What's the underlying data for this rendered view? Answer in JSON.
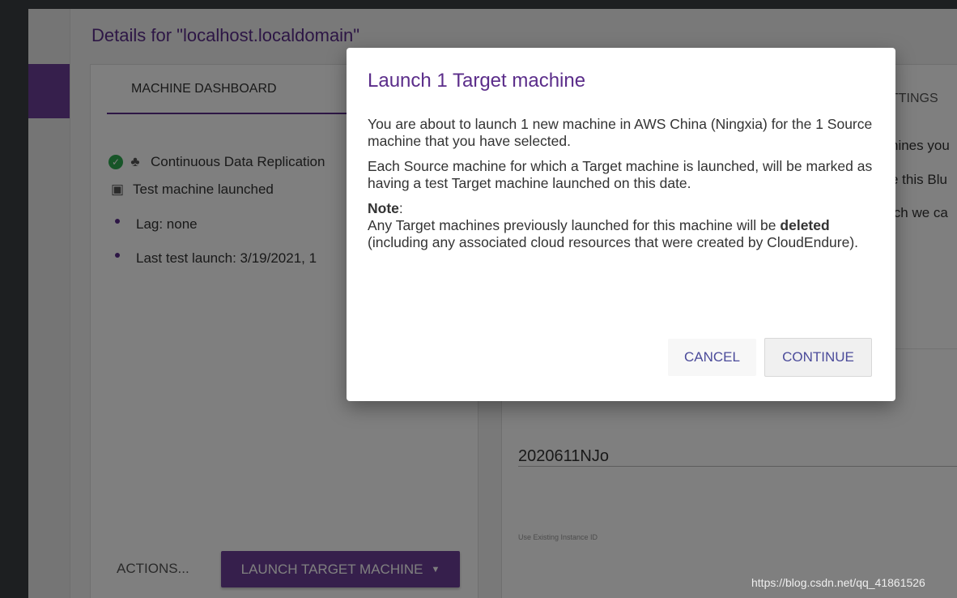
{
  "page": {
    "title": "Details for \"localhost.localdomain\""
  },
  "left_card": {
    "tab_label": "MACHINE DASHBOARD",
    "status_items": [
      {
        "label": "Continuous Data Replication",
        "icon": "check-icon"
      },
      {
        "label": "Test machine launched",
        "icon": "test-launched-icon"
      },
      {
        "label": "Lag: none",
        "icon": "bullet"
      },
      {
        "label": "Last test launch: 3/19/2021, 1",
        "icon": "bullet"
      }
    ],
    "actions_label": "ACTIONS...",
    "launch_button_label": "LAUNCH TARGET MACHINE"
  },
  "right_card": {
    "tab_label": "TTINGS",
    "line1": "hines you",
    "line2": "e this Blu",
    "line3": "ich we ca",
    "field_value": "2020611NJo",
    "small_label": "Use Existing Instance ID"
  },
  "dialog": {
    "title": "Launch 1 Target machine",
    "para1": "You are about to launch 1 new machine in AWS China (Ningxia) for the 1 Source machine that you have selected.",
    "para2": "Each Source machine for which a Target machine is launched, will be marked as having a test Target machine launched on this date.",
    "note_heading": "Note",
    "note_colon": ":",
    "note_text_before": "Any Target machines previously launched for this machine will be",
    "note_bold": "deleted",
    "note_text_after": "(including any associated cloud resources that were created by CloudEndure).",
    "cancel_label": "CANCEL",
    "continue_label": "CONTINUE"
  },
  "watermark": "https://blog.csdn.net/qq_41861526",
  "colors": {
    "accent": "#6c3f98",
    "title_purple": "#5b2d8a",
    "success": "#2eaa50"
  }
}
